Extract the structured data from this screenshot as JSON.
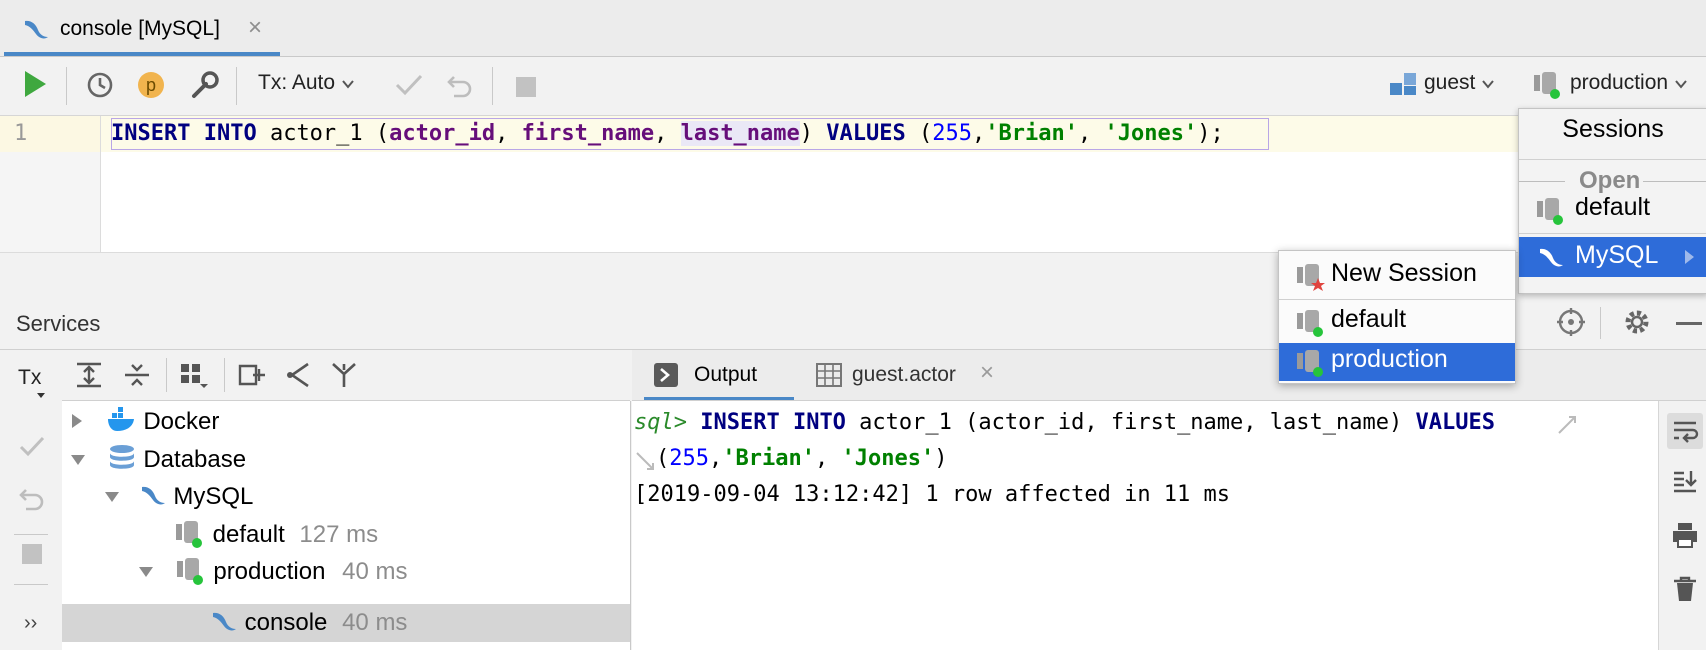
{
  "editor_tab": {
    "title": "console [MySQL]",
    "close": "×"
  },
  "toolbar": {
    "profile_badge": "p",
    "tx_mode": "Tx: Auto",
    "schema": "guest",
    "session": "production"
  },
  "editor": {
    "line_number": "1",
    "tokens": {
      "kw1": "INSERT INTO",
      "table": " actor_1 (",
      "c1": "actor_id",
      "p1": ", ",
      "c2": "first_name",
      "p2": ", ",
      "c3": "last_name",
      "p3": ") ",
      "kw2": "VALUES",
      "p4": " (",
      "n1": "255",
      "p5": ",",
      "s1": "'Brian'",
      "p6": ", ",
      "s2": "'Jones'",
      "p7": ");"
    }
  },
  "services": {
    "title": "Services",
    "tx_label": "Tx",
    "expand_label": "››",
    "tree": {
      "docker": "Docker",
      "database": "Database",
      "mysql": "MySQL",
      "default": {
        "name": "default",
        "time": "127 ms"
      },
      "production": {
        "name": "production",
        "time": "40 ms"
      },
      "console": {
        "name": "console",
        "time": "40 ms"
      }
    }
  },
  "output_tabs": [
    {
      "label": "Output"
    },
    {
      "label": "guest.actor",
      "close": "×"
    }
  ],
  "output": {
    "prompt": "sql>",
    "line1_kw1": "INSERT INTO",
    "line1_mid": " actor_1 (actor_id, first_name, last_name) ",
    "line1_kw2": "VALUES",
    "line2_open": "(",
    "line2_num": "255",
    "line2_comma": ",",
    "line2_s1": "'Brian'",
    "line2_comma2": ", ",
    "line2_s2": "'Jones'",
    "line2_close": ")",
    "line3": "[2019-09-04 13:12:42] 1 row affected in 11 ms"
  },
  "sessions_popup": {
    "title": "Sessions",
    "open_label": "Open",
    "default": "default",
    "mysql": "MySQL"
  },
  "submenu": {
    "new_session": "New Session",
    "default": "default",
    "production": "production"
  },
  "colors": {
    "accent": "#4a88c7",
    "selection": "#2e6cd9",
    "run_green": "#3fa83f",
    "keyword": "#000080",
    "string": "#008000",
    "number": "#0000ff"
  }
}
